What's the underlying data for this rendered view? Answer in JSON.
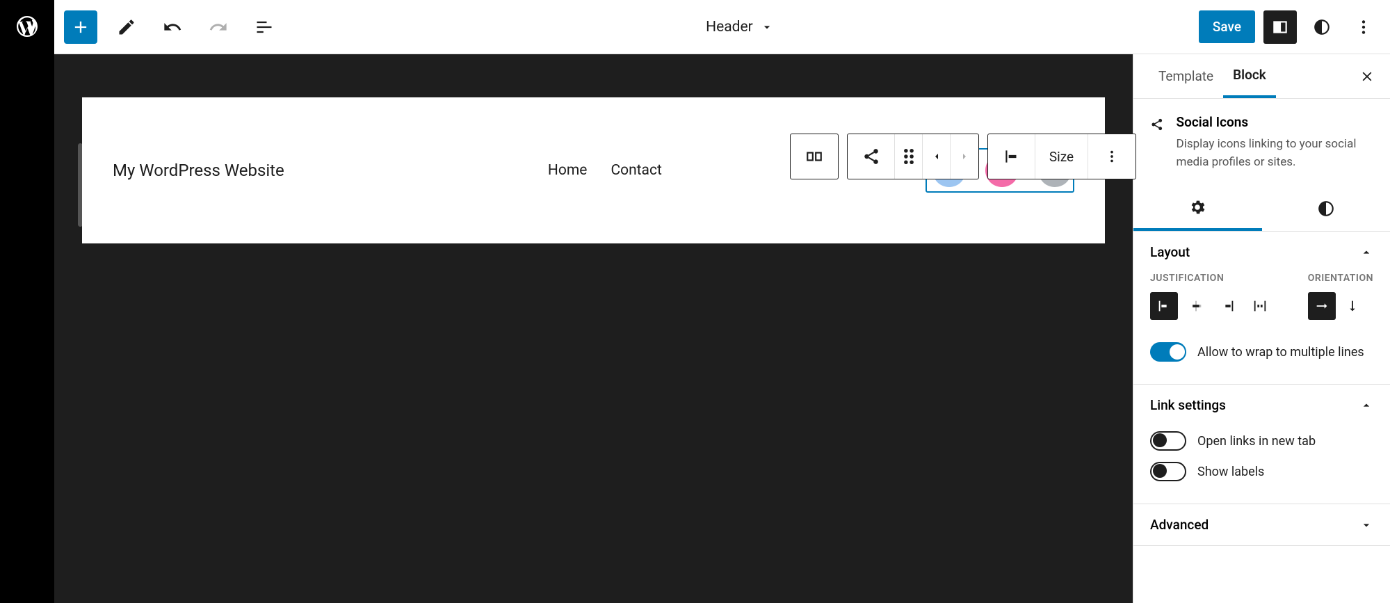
{
  "topbar": {
    "document_title": "Header",
    "save_label": "Save"
  },
  "canvas": {
    "site_title": "My WordPress Website",
    "nav": [
      "Home",
      "Contact"
    ]
  },
  "block_toolbar": {
    "size_label": "Size"
  },
  "sidebar": {
    "tabs": {
      "template": "Template",
      "block": "Block"
    },
    "block_info": {
      "title": "Social Icons",
      "description": "Display icons linking to your social media profiles or sites."
    },
    "panels": {
      "layout": {
        "title": "Layout",
        "justification_label": "Justification",
        "orientation_label": "Orientation",
        "wrap_label": "Allow to wrap to multiple lines"
      },
      "link_settings": {
        "title": "Link settings",
        "open_new_tab_label": "Open links in new tab",
        "show_labels_label": "Show labels"
      },
      "advanced": {
        "title": "Advanced"
      }
    }
  }
}
